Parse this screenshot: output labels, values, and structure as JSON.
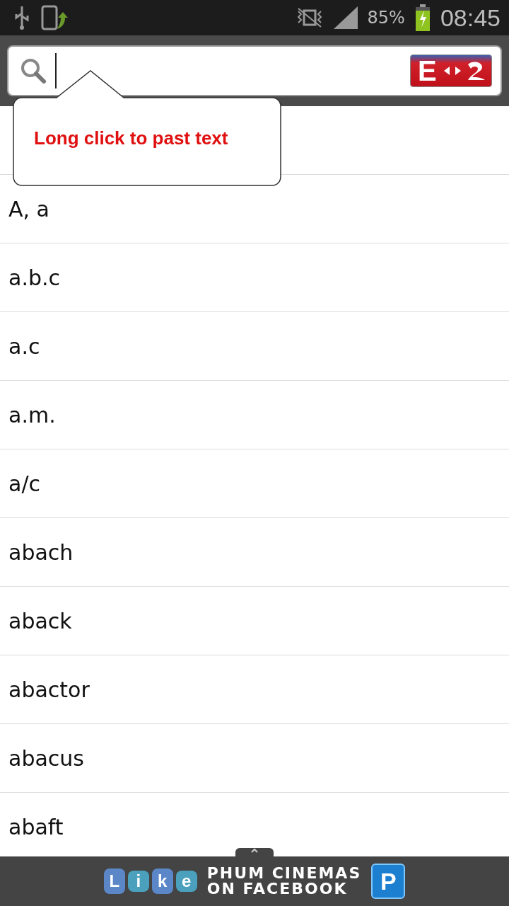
{
  "status_bar": {
    "battery_percent": "85%",
    "time": "08:45"
  },
  "search": {
    "logo_letter": "E"
  },
  "tooltip": {
    "text": "Long click to past text"
  },
  "word_list": {
    "rows": [
      {
        "word": "A, a"
      },
      {
        "word": "a.b.c"
      },
      {
        "word": "a.c"
      },
      {
        "word": "a.m."
      },
      {
        "word": "a/c"
      },
      {
        "word": "abach"
      },
      {
        "word": "aback"
      },
      {
        "word": "abactor"
      },
      {
        "word": "abacus"
      },
      {
        "word": "abaft"
      }
    ]
  },
  "ad_banner": {
    "like_letters": [
      "L",
      "i",
      "k",
      "e"
    ],
    "lines": [
      "PHUM CINEMAS",
      "ON FACEBOOK"
    ],
    "badge": "P"
  }
}
